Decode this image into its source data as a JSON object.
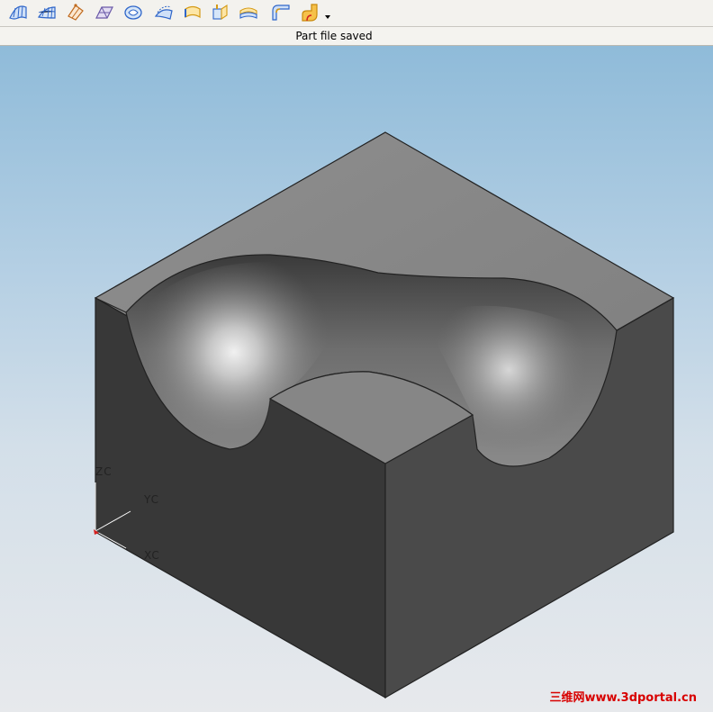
{
  "toolbar": {
    "buttons": [
      {
        "name": "through-curves-icon",
        "color": "#2f66c9"
      },
      {
        "name": "through-curve-mesh-icon",
        "color": "#2f66c9"
      },
      {
        "name": "swept-surface-icon",
        "color": "#c06a1e"
      },
      {
        "name": "section-surface-icon",
        "color": "#6b5aa8"
      },
      {
        "name": "bounded-plane-icon",
        "color": "#2f66c9"
      },
      {
        "name": "offset-surface-icon",
        "color": "#2f66c9"
      },
      {
        "name": "extension-icon",
        "color": "#d59a14"
      },
      {
        "name": "law-extension-icon",
        "color": "#d59a14"
      },
      {
        "name": "trimmed-sheet-icon",
        "color": "#d59a14"
      },
      {
        "name": "face-blend-icon",
        "color": "#2f66c9"
      },
      {
        "name": "styled-blend-icon",
        "color": "#e2a012"
      }
    ]
  },
  "status": {
    "message": "Part file saved"
  },
  "axes": {
    "z_label": "ZC",
    "y_label": "YC",
    "x_label": "XC"
  },
  "watermark": "三维网www.3dportal.cn",
  "colors": {
    "toolbar_bg": "#f3f2ee",
    "viewport_top": "#8fbbd9",
    "viewport_bottom": "#e7e9ec",
    "block_top": "#878787",
    "block_left": "#3a3a3a",
    "block_right": "#4a4a4a",
    "watermark": "#d80000"
  }
}
